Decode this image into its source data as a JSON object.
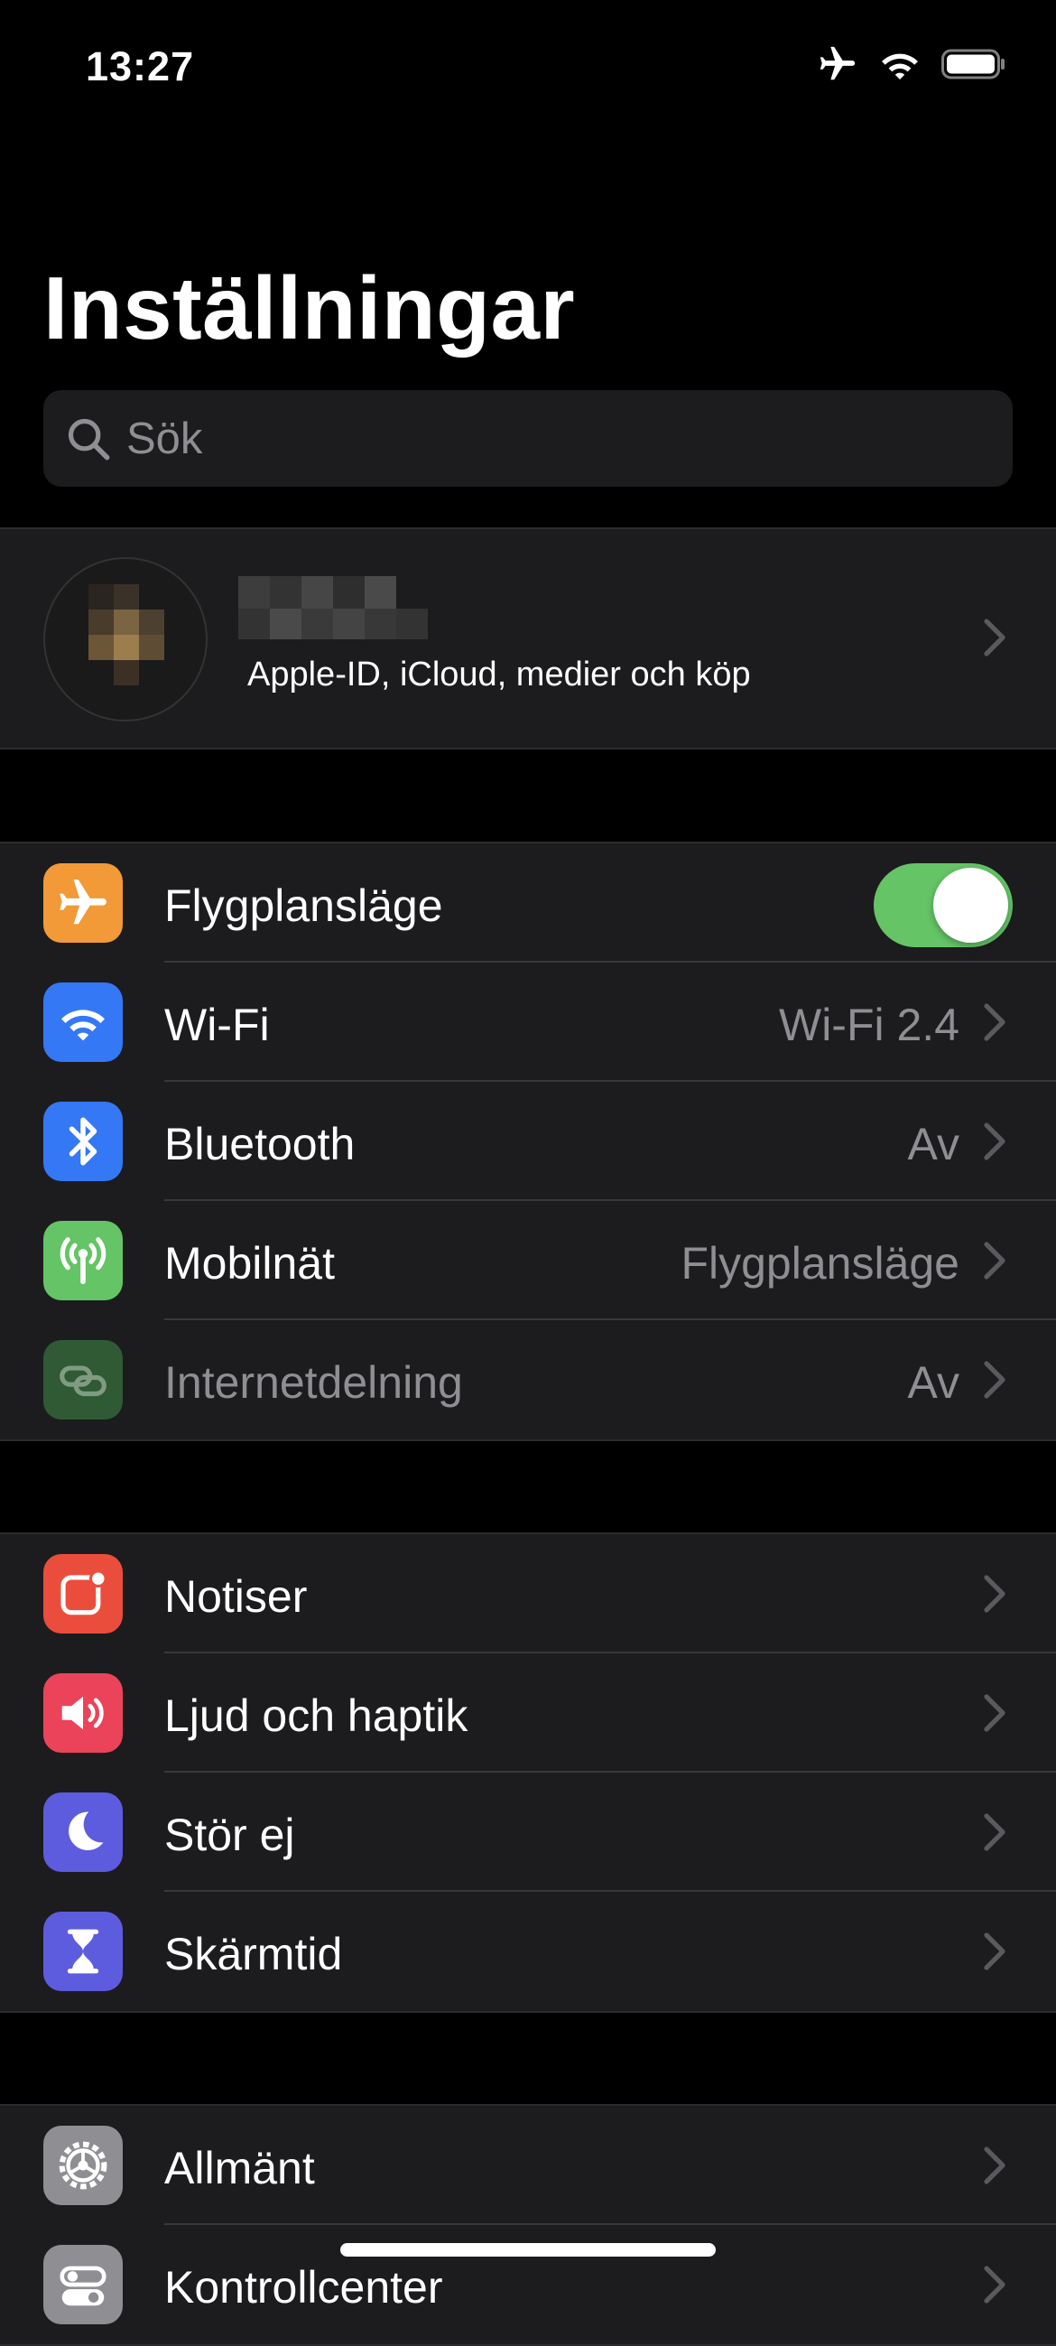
{
  "status_bar": {
    "time": "13:27",
    "icons": [
      "airplane-icon",
      "wifi-icon",
      "battery-icon"
    ]
  },
  "title": "Inställningar",
  "search": {
    "placeholder": "Sök"
  },
  "profile": {
    "subtitle": "Apple-ID, iCloud, medier och köp"
  },
  "groups": {
    "connectivity": [
      {
        "label": "Flygplansläge",
        "icon": "airplane-icon",
        "color": "#f19a37",
        "toggle": true
      },
      {
        "label": "Wi-Fi",
        "icon": "wifi-icon",
        "color": "#3478f6",
        "value": "Wi-Fi 2.4"
      },
      {
        "label": "Bluetooth",
        "icon": "bluetooth-icon",
        "color": "#3478f6",
        "value": "Av"
      },
      {
        "label": "Mobilnät",
        "icon": "antenna-icon",
        "color": "#65c466",
        "value": "Flygplansläge"
      },
      {
        "label": "Internetdelning",
        "icon": "link-icon",
        "color": "#2f5a34",
        "value": "Av"
      }
    ],
    "notifications": [
      {
        "label": "Notiser",
        "icon": "notifications-icon",
        "color": "#eb4d3d"
      },
      {
        "label": "Ljud och haptik",
        "icon": "speaker-icon",
        "color": "#eb445a"
      },
      {
        "label": "Stör ej",
        "icon": "moon-icon",
        "color": "#5d5cde"
      },
      {
        "label": "Skärmtid",
        "icon": "hourglass-icon",
        "color": "#5d5cde"
      }
    ],
    "general": [
      {
        "label": "Allmänt",
        "icon": "gear-icon",
        "color": "#8e8e93"
      },
      {
        "label": "Kontrollcenter",
        "icon": "switches-icon",
        "color": "#8e8e93"
      }
    ]
  }
}
